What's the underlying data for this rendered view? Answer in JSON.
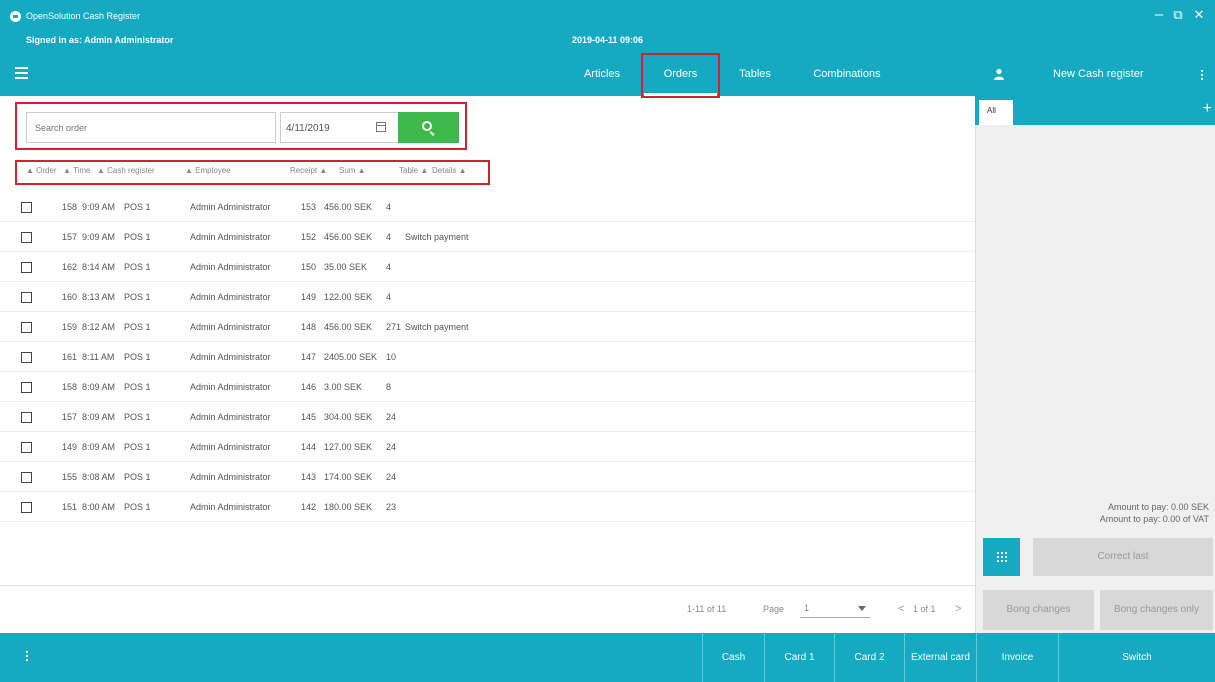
{
  "window": {
    "title": "OpenSolution Cash Register",
    "signed_in": "Signed in as: Admin Administrator",
    "datetime": "2019-04-11 09:06",
    "controls": {
      "minimize": "–",
      "restore": "⧉",
      "close": "✕"
    }
  },
  "nav": {
    "menu_icon": "hamburger-menu-icon",
    "tabs": [
      {
        "label": "Articles",
        "active": false
      },
      {
        "label": "Orders",
        "active": true
      },
      {
        "label": "Tables",
        "active": false
      },
      {
        "label": "Combinations",
        "active": false
      }
    ]
  },
  "search": {
    "placeholder": "Search order",
    "date": "4/11/2019",
    "calendar_icon": "calendar-icon",
    "search_icon": "search-icon"
  },
  "columns": {
    "order": "▲ Order",
    "time": "▲ Time",
    "cash_register": "▲ Cash register",
    "employee": "▲ Employee",
    "receipt": "Receipt ▲",
    "sum": "Sum ▲",
    "table": "Table ▲",
    "details": "Details ▲"
  },
  "orders": [
    {
      "order": "158",
      "time": "9:09 AM",
      "register": "POS 1",
      "employee": "Admin Administrator",
      "receipt": "153",
      "sum": "456.00 SEK",
      "table": "4",
      "details": ""
    },
    {
      "order": "157",
      "time": "9:09 AM",
      "register": "POS 1",
      "employee": "Admin Administrator",
      "receipt": "152",
      "sum": "456.00 SEK",
      "table": "4",
      "details": "Switch payment"
    },
    {
      "order": "162",
      "time": "8:14 AM",
      "register": "POS 1",
      "employee": "Admin Administrator",
      "receipt": "150",
      "sum": "35.00 SEK",
      "table": "4",
      "details": ""
    },
    {
      "order": "160",
      "time": "8:13 AM",
      "register": "POS 1",
      "employee": "Admin Administrator",
      "receipt": "149",
      "sum": "122.00 SEK",
      "table": "4",
      "details": ""
    },
    {
      "order": "159",
      "time": "8:12 AM",
      "register": "POS 1",
      "employee": "Admin Administrator",
      "receipt": "148",
      "sum": "456.00 SEK",
      "table": "271",
      "details": "Switch payment"
    },
    {
      "order": "161",
      "time": "8:11 AM",
      "register": "POS 1",
      "employee": "Admin Administrator",
      "receipt": "147",
      "sum": "2405.00 SEK",
      "table": "10",
      "details": ""
    },
    {
      "order": "158",
      "time": "8:09 AM",
      "register": "POS 1",
      "employee": "Admin Administrator",
      "receipt": "146",
      "sum": "3.00 SEK",
      "table": "8",
      "details": ""
    },
    {
      "order": "157",
      "time": "8:09 AM",
      "register": "POS 1",
      "employee": "Admin Administrator",
      "receipt": "145",
      "sum": "304.00 SEK",
      "table": "24",
      "details": ""
    },
    {
      "order": "149",
      "time": "8:09 AM",
      "register": "POS 1",
      "employee": "Admin Administrator",
      "receipt": "144",
      "sum": "127.00 SEK",
      "table": "24",
      "details": ""
    },
    {
      "order": "155",
      "time": "8:08 AM",
      "register": "POS 1",
      "employee": "Admin Administrator",
      "receipt": "143",
      "sum": "174.00 SEK",
      "table": "24",
      "details": ""
    },
    {
      "order": "151",
      "time": "8:00 AM",
      "register": "POS 1",
      "employee": "Admin Administrator",
      "receipt": "142",
      "sum": "180.00 SEK",
      "table": "23",
      "details": ""
    }
  ],
  "pager": {
    "range": "1-11 of 11",
    "page_label": "Page",
    "page_value": "1",
    "prev": "<",
    "position": "1 of 1",
    "next": ">"
  },
  "right": {
    "register_name": "New Cash register",
    "user_icon": "user-icon",
    "tab_all": "All",
    "add_tab": "+",
    "amount_to_pay": "Amount to pay: 0.00 SEK",
    "amount_vat": "Amount to pay: 0.00 of VAT",
    "keypad_icon": "keypad-icon",
    "correct_last": "Correct last",
    "bong_changes": "Bong changes",
    "bong_changes_only": "Bong changes only"
  },
  "footer": {
    "menu_icon": "more-vertical-icon",
    "buttons": [
      "Cash",
      "Card 1",
      "Card 2",
      "External card",
      "Invoice",
      "Switch"
    ]
  },
  "colors": {
    "primary": "#15a9c2",
    "search_button": "#3fb84b",
    "highlight": "#d42030"
  }
}
